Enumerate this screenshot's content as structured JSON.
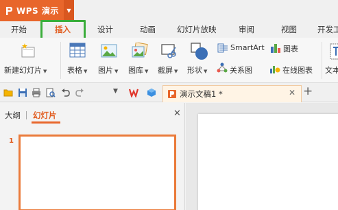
{
  "app": {
    "title": "WPS 演示",
    "brand_color": "#e8662b"
  },
  "tabs": [
    {
      "label": "开始"
    },
    {
      "label": "插入",
      "active": true
    },
    {
      "label": "设计"
    },
    {
      "label": "动画"
    },
    {
      "label": "幻灯片放映"
    },
    {
      "label": "审阅"
    },
    {
      "label": "视图"
    },
    {
      "label": "开发工"
    }
  ],
  "ribbon": {
    "new_slide": "新建幻灯片",
    "table": "表格",
    "picture": "图片",
    "gallery": "图库",
    "screenshot": "截屏",
    "shapes": "形状",
    "smartart": "SmartArt",
    "chart": "图表",
    "relation": "关系图",
    "online_chart": "在线图表",
    "text": "文本"
  },
  "quick_access": {
    "document_tab": "演示文稿1 *",
    "icons": [
      "open-icon",
      "save-icon",
      "print-icon",
      "print-preview-icon",
      "undo-icon",
      "redo-icon",
      "dropdown-icon",
      "wps-logo-icon",
      "cube-icon"
    ]
  },
  "left_panel": {
    "outline_tab": "大纲",
    "slides_tab": "幻灯片",
    "slide_number": "1"
  },
  "colors": {
    "accent": "#e8662b",
    "highlight_box": "#3aad3a"
  }
}
